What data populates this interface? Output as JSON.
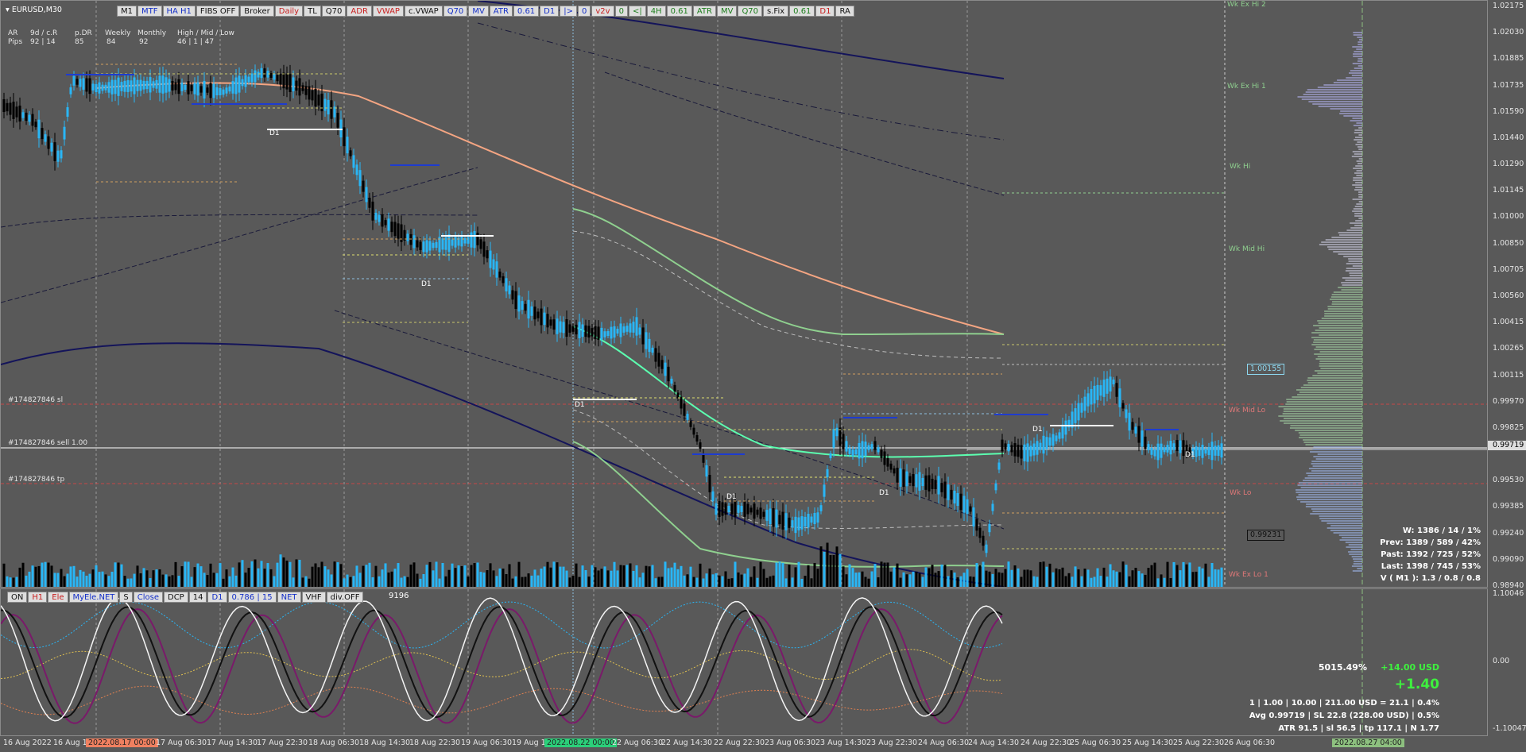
{
  "symbol": "EURUSD,M30",
  "toolbar_top": [
    {
      "label": "M1",
      "style": "dark"
    },
    {
      "label": "MTF",
      "style": "blue"
    },
    {
      "label": "HA H1",
      "style": "blue"
    },
    {
      "label": "FIBS OFF",
      "style": "dark"
    },
    {
      "label": "Broker",
      "style": "dark"
    },
    {
      "label": "Daily",
      "style": "red"
    },
    {
      "label": "TL",
      "style": "dark"
    },
    {
      "label": "Q70",
      "style": "dark"
    },
    {
      "label": "ADR",
      "style": "red"
    },
    {
      "label": "VWAP",
      "style": "red"
    },
    {
      "label": "c.VWAP",
      "style": "dark"
    },
    {
      "label": "Q70",
      "style": "blue"
    },
    {
      "label": "MV",
      "style": "blue"
    },
    {
      "label": "ATR",
      "style": "blue"
    },
    {
      "label": "0.61",
      "style": "blue"
    },
    {
      "label": "D1",
      "style": "blue"
    },
    {
      "label": "|>",
      "style": "blue"
    },
    {
      "label": "0",
      "style": "blue"
    },
    {
      "label": "v2v",
      "style": "red"
    },
    {
      "label": "0",
      "style": "green"
    },
    {
      "label": "<|",
      "style": "green"
    },
    {
      "label": "4H",
      "style": "green"
    },
    {
      "label": "0.61",
      "style": "green"
    },
    {
      "label": "ATR",
      "style": "green"
    },
    {
      "label": "MV",
      "style": "green"
    },
    {
      "label": "Q70",
      "style": "green"
    },
    {
      "label": "s.Fix",
      "style": "dark"
    },
    {
      "label": "0.61",
      "style": "green"
    },
    {
      "label": "D1",
      "style": "red"
    },
    {
      "label": "RA",
      "style": "dark"
    }
  ],
  "info_header": {
    "ar": "AR",
    "range": "9d / c.R",
    "pdr": "p.DR",
    "weekly": "Weekly",
    "monthly": "Monthly",
    "hml": "High / Mid / Low",
    "pips": "Pips",
    "v1": "92 | 14",
    "v2": "85",
    "v3": "84",
    "v4": "92",
    "v5": "46 | 1 | 47"
  },
  "order_labels": {
    "sl": "#174827846 sl",
    "sell": "#174827846 sell 1.00",
    "tp": "#174827846 tp"
  },
  "level_labels": {
    "wk_ex_hi2": "Wk Ex Hi 2",
    "wk_ex_hi1": "Wk Ex Hi 1",
    "wk_hi": "Wk Hi",
    "wk_mid_hi": "Wk Mid Hi",
    "wk_mid_lo": "Wk Mid Lo",
    "wk_lo": "Wk Lo",
    "wk_ex_lo1": "Wk Ex Lo 1",
    "d1": "D1"
  },
  "price_boxes": {
    "a": "1.00155",
    "b": "0.99231"
  },
  "y_axis_labels": [
    "1.02175",
    "1.02030",
    "1.01885",
    "1.01735",
    "1.01590",
    "1.01440",
    "1.01290",
    "1.01145",
    "1.01000",
    "1.00850",
    "1.00705",
    "1.00560",
    "1.00415",
    "1.00265",
    "1.00115",
    "0.99970",
    "0.99825",
    "0.99719",
    "0.99530",
    "0.99385",
    "0.99240",
    "0.99090",
    "0.98940"
  ],
  "sub_y_labels": {
    "top": "1.10046",
    "mid": "0.00",
    "bot": "-1.10047"
  },
  "current_price": "0.99719",
  "x_axis_labels": [
    "16 Aug 2022",
    "16 Aug 1",
    "2022.08.17 00:00",
    "17 Aug 06:30",
    "17 Aug 14:30",
    "17 Aug 22:30",
    "18 Aug 06:30",
    "18 Aug 14:30",
    "18 Aug 22:30",
    "19 Aug 06:30",
    "19 Aug 1",
    "2022.08.22 00:00",
    "22 Aug 06:30",
    "22 Aug 14:30",
    "22 Aug 22:30",
    "23 Aug 06:30",
    "23 Aug 14:30",
    "23 Aug 22:30",
    "24 Aug 06:30",
    "24 Aug 14:30",
    "24 Aug 22:30",
    "25 Aug 06:30",
    "25 Aug 14:30",
    "25 Aug 22:30",
    "26 Aug 06:30",
    "2022.08.27 04:00"
  ],
  "stats": {
    "w": "W: 1386 / 14 / 1%",
    "prev": "Prev: 1389 / 589 / 42%",
    "past": "Past: 1392 / 725 / 52%",
    "last": "Last: 1398 / 745 / 53%",
    "v": "V ( M1 ): 1.3 / 0.8 / 0.8"
  },
  "account": {
    "pct": "5015.49%",
    "usd": "+14.00 USD",
    "big": "+1.40",
    "line1": "1  |  1.00  |  10.00  |  211.00 USD = 21.1  |  0.4%",
    "line2": "Avg 0.99719  |  SL 22.8 (228.00 USD)  |  0.5%",
    "line3": "ATR 91.5  | sl 56.5  |  tp 117.1  |  N 1.77"
  },
  "toolbar_sub": [
    {
      "label": "ON",
      "style": "dark"
    },
    {
      "label": "H1",
      "style": "red"
    },
    {
      "label": "Ele",
      "style": "red"
    },
    {
      "label": "MyEle.NET",
      "style": "blue"
    },
    {
      "label": "S",
      "style": "dark"
    },
    {
      "label": "Close",
      "style": "blue"
    },
    {
      "label": "DCP",
      "style": "dark"
    },
    {
      "label": "14",
      "style": "dark"
    },
    {
      "label": "D1",
      "style": "blue"
    },
    {
      "label": "0.786 | 15",
      "style": "blue"
    },
    {
      "label": "NET",
      "style": "blue"
    },
    {
      "label": "VHF",
      "style": "dark"
    },
    {
      "label": "div.OFF",
      "style": "dark"
    }
  ],
  "sub_value": "9196",
  "colors": {
    "bg": "#595959",
    "bull": "#29b6f6",
    "bear": "#000000",
    "ema_salmon": "#f4a582",
    "navy": "#14145a",
    "green": "#7fc97f",
    "lime": "#5cffb0"
  }
}
